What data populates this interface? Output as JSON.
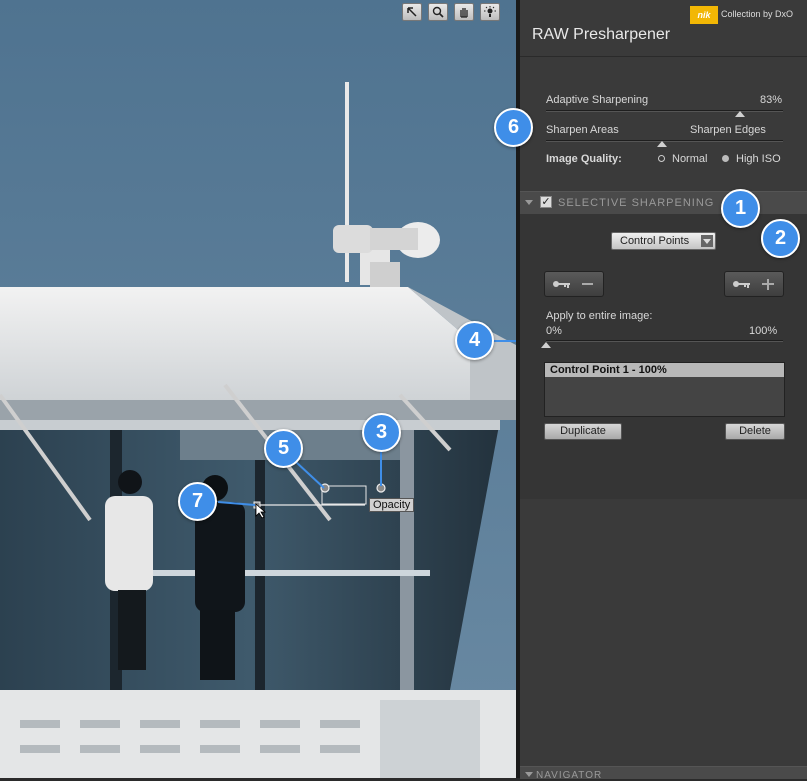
{
  "toolbar": {
    "tools": [
      {
        "name": "arrow-tool-icon"
      },
      {
        "name": "zoom-tool-icon"
      },
      {
        "name": "hand-tool-icon"
      },
      {
        "name": "light-tool-icon"
      }
    ]
  },
  "brand": {
    "badge": "nik",
    "collection": "Collection by DxO",
    "badge_color": "#f2b705"
  },
  "panel": {
    "title": "RAW Presharpener",
    "adaptive": {
      "label": "Adaptive Sharpening",
      "value": "83%",
      "level": 0.83
    },
    "sharpen": {
      "left": "Sharpen Areas",
      "right": "Sharpen Edges",
      "level": 0.5
    },
    "quality": {
      "label": "Image Quality:",
      "normal": "Normal",
      "high": "High ISO",
      "selected": "high"
    }
  },
  "selective": {
    "title": "SELECTIVE SHARPENING",
    "checked": "✓",
    "dropdown": "Control Points",
    "apply_label": "Apply to entire image:",
    "apply_min": "0%",
    "apply_max": "100%",
    "apply_level": 0,
    "list": [
      "Control Point 1 - 100%"
    ],
    "duplicate": "Duplicate",
    "delete": "Delete"
  },
  "navigator": {
    "title": "NAVIGATOR"
  },
  "canvas": {
    "opacity_label": "Opacity"
  },
  "callouts": [
    "1",
    "2",
    "3",
    "4",
    "5",
    "6",
    "7"
  ],
  "colors": {
    "accent": "#3f8ee8",
    "sky": "#5c7d97"
  }
}
